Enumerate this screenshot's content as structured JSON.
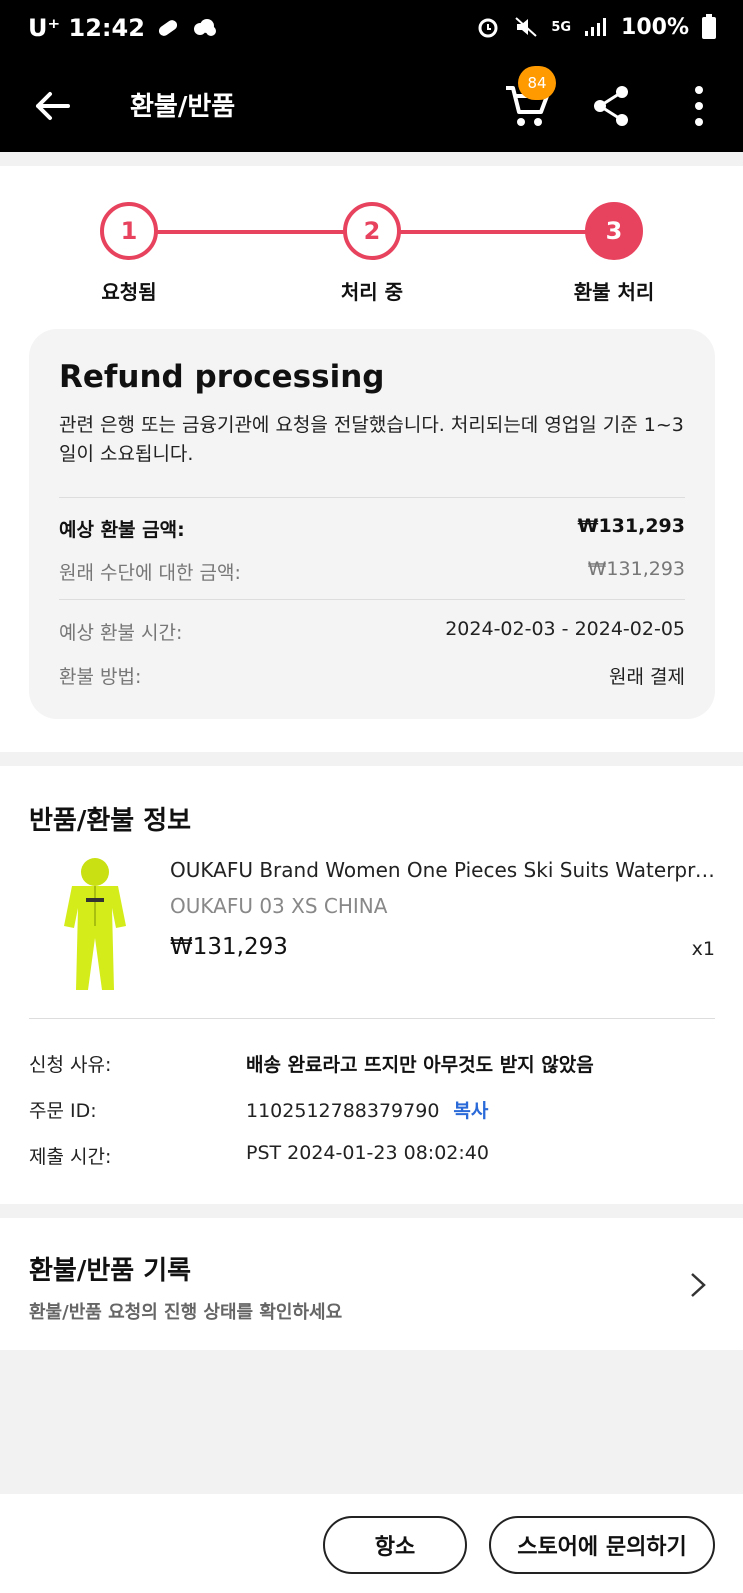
{
  "status_bar": {
    "carrier_time": "U⁺ 12:42",
    "battery": "100%",
    "network": "5G"
  },
  "app_bar": {
    "title": "환불/반품",
    "cart_count": "84",
    "icons": [
      "back-arrow-icon",
      "cart-icon",
      "share-icon",
      "more-vert-icon"
    ]
  },
  "steps": [
    {
      "number": "1",
      "label": "요청됨"
    },
    {
      "number": "2",
      "label": "처리 중"
    },
    {
      "number": "3",
      "label": "환불 처리"
    }
  ],
  "refund_box": {
    "title": "Refund processing",
    "description": "관련 은행 또는 금융기관에 요청을 전달했습니다. 처리되는데 영업일 기준 1~3 일이 소요됩니다.",
    "estimated_amount_label": "예상 환불 금액:",
    "estimated_amount_value": "₩131,293",
    "original_method_label": "원래 수단에 대한 금액:",
    "original_method_value": "₩131,293",
    "estimated_time_label": "예상 환불 시간:",
    "estimated_time_value": "2024-02-03 - 2024-02-05",
    "method_label": "환불 방법:",
    "method_value": "원래 결제"
  },
  "return_info": {
    "title": "반품/환불 정보",
    "product": {
      "name": "OUKAFU Brand Women One Pieces Ski Suits Waterproof",
      "sku": "OUKAFU 03 XS CHINA",
      "price": "₩131,293",
      "qty": "x1"
    },
    "reason_label": "신청 사유:",
    "reason_value": "배송 완료라고 뜨지만 아무것도 받지 않았음",
    "order_id_label": "주문 ID:",
    "order_id_value": "1102512788379790",
    "copy_label": "복사",
    "submit_time_label": "제출 시간:",
    "submit_time_value": "PST 2024-01-23 08:02:40"
  },
  "history": {
    "title": "환불/반품 기록",
    "subtitle": "환불/반품 요청의 진행 상태를 확인하세요"
  },
  "bottom_buttons": {
    "appeal": "항소",
    "contact_store": "스토어에 문의하기"
  },
  "colors": {
    "accent": "#e8435e",
    "badge": "#ff9a00",
    "link": "#2a6ad8",
    "product": "#d4ec1a"
  }
}
